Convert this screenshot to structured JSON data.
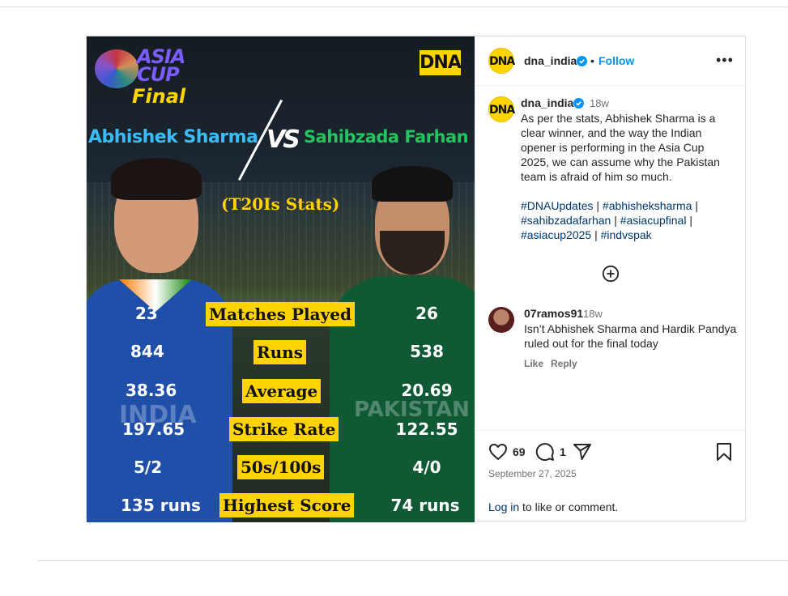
{
  "post": {
    "image": {
      "logo_top": "ASIA CUP",
      "logo_bottom": "Final",
      "brand_badge": "DNA",
      "player_left": "Abhishek Sharma",
      "versus": "VS",
      "player_right": "Sahibzada Farhan",
      "subtitle": "(T20Is Stats)",
      "stats": [
        {
          "left": "23",
          "label": "Matches Played",
          "right": "26"
        },
        {
          "left": "844",
          "label": "Runs",
          "right": "538"
        },
        {
          "left": "38.36",
          "label": "Average",
          "right": "20.69"
        },
        {
          "left": "197.65",
          "label": "Strike Rate",
          "right": "122.55"
        },
        {
          "left": "5/2",
          "label": "50s/100s",
          "right": "4/0"
        },
        {
          "left": "135 runs",
          "label": "Highest Score",
          "right": "74 runs"
        }
      ]
    },
    "header": {
      "avatar_text": "DNA",
      "username": "dna_india",
      "separator": "•",
      "follow_label": "Follow",
      "more_label": "•••"
    },
    "caption": {
      "username": "dna_india",
      "time": "18w",
      "text": "As per the stats, Abhishek Sharma is a clear winner, and the way the Indian opener is performing in the Asia Cup 2025, we can assume why the Pakistan team is afraid of him so much.",
      "hashtags": [
        "#DNAUpdates",
        "#abhisheksharma",
        "#sahibzadafarhan",
        "#asiacupfinal",
        "#asiacup2025",
        "#indvspak"
      ],
      "hashtag_separator": " | "
    },
    "comment": {
      "username": "07ramos91",
      "time": "18w",
      "text": "Isn’t Abhishek Sharma and Hardik Pandya ruled out for the final today",
      "like_label": "Like",
      "reply_label": "Reply"
    },
    "footer": {
      "likes_count": "69",
      "comments_count": "1",
      "date": "September 27, 2025",
      "login_link": "Log in",
      "login_suffix": " to like or comment."
    },
    "colors": {
      "follow_blue": "#0095f6",
      "hashtag_blue": "#00376b",
      "stat_label_yellow": "#ffd400",
      "left_name_blue": "#38bdf8",
      "right_name_green": "#22c55e"
    },
    "icons": [
      "heart-icon",
      "comment-icon",
      "share-icon",
      "bookmark-icon",
      "add-circle-icon",
      "verified-icon",
      "more-icon"
    ]
  }
}
